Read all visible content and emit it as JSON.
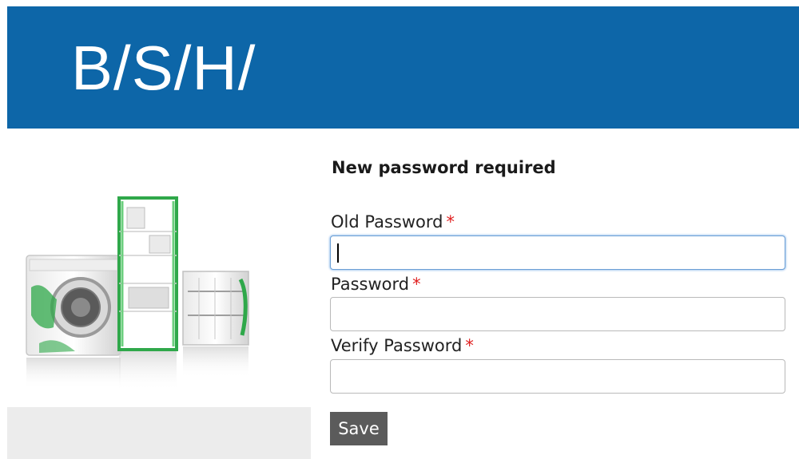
{
  "header": {
    "logo_text": "B/S/H/",
    "background_color": "#0d66a8"
  },
  "form": {
    "title": "New password required",
    "required_marker": "*",
    "fields": [
      {
        "label": "Old Password",
        "value": ""
      },
      {
        "label": "Password",
        "value": ""
      },
      {
        "label": "Verify Password",
        "value": ""
      }
    ],
    "save_label": "Save"
  },
  "colors": {
    "required": "#e02020",
    "button": "#5b5b5b",
    "appliance_green": "#2fa84a"
  }
}
